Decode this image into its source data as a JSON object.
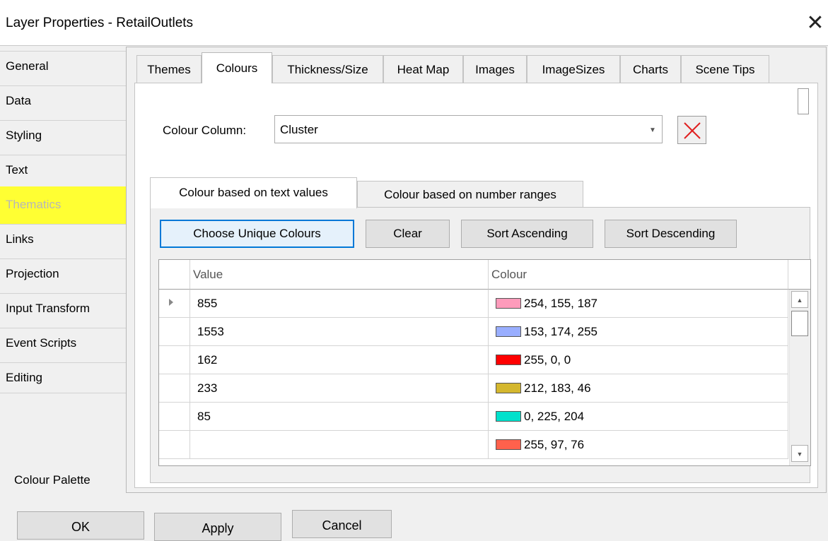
{
  "window": {
    "title": "Layer Properties - RetailOutlets",
    "close_glyph": "✕"
  },
  "nav": {
    "items": [
      {
        "label": "General"
      },
      {
        "label": "Data"
      },
      {
        "label": "Styling"
      },
      {
        "label": "Text"
      },
      {
        "label": "Thematics"
      },
      {
        "label": "Links"
      },
      {
        "label": "Projection"
      },
      {
        "label": "Input Transform"
      },
      {
        "label": "Event Scripts"
      },
      {
        "label": "Editing"
      }
    ],
    "selected": "Thematics",
    "highlight_color": "#ffff33",
    "footer_label": "Colour Palette"
  },
  "tabs": {
    "items": [
      {
        "label": "Themes"
      },
      {
        "label": "Colours"
      },
      {
        "label": "Thickness/Size"
      },
      {
        "label": "Heat Map"
      },
      {
        "label": "Images"
      },
      {
        "label": "ImageSizes"
      },
      {
        "label": "Charts"
      },
      {
        "label": "Scene Tips"
      }
    ],
    "active": "Colours"
  },
  "colour_column": {
    "label": "Colour Column:",
    "value": "Cluster",
    "clear_icon": "red-x-icon"
  },
  "inner_tabs": {
    "items": [
      {
        "label": "Colour based on text values"
      },
      {
        "label": "Colour based on number ranges"
      }
    ],
    "active": "Colour based on text values"
  },
  "buttons": {
    "choose_unique": "Choose Unique Colours",
    "clear": "Clear",
    "sort_asc": "Sort Ascending",
    "sort_desc": "Sort Descending"
  },
  "grid": {
    "columns": [
      "Value",
      "Colour"
    ],
    "rows": [
      {
        "value": "855",
        "colour": "254, 155, 187",
        "hex": "#fe9bbb"
      },
      {
        "value": "1553",
        "colour": "153, 174, 255",
        "hex": "#99aeff"
      },
      {
        "value": "162",
        "colour": "255, 0, 0",
        "hex": "#ff0000"
      },
      {
        "value": "233",
        "colour": "212, 183, 46",
        "hex": "#d4b72e"
      },
      {
        "value": "85",
        "colour": "0, 225, 204",
        "hex": "#00e1cc"
      },
      {
        "value": "",
        "colour": "255, 97, 76",
        "hex": "#ff614c"
      }
    ],
    "current_row": 0
  },
  "dialog_buttons": {
    "ok": "OK",
    "apply": "Apply",
    "cancel": "Cancel"
  }
}
